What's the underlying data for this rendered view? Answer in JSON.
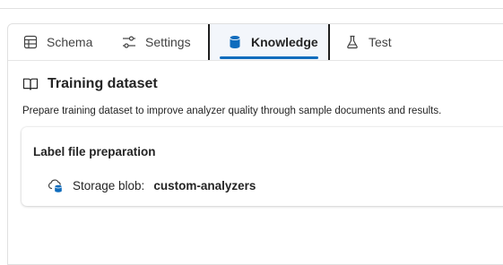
{
  "tabs": [
    {
      "label": "Schema",
      "icon": "table-icon",
      "selected": false
    },
    {
      "label": "Settings",
      "icon": "sliders-icon",
      "selected": false
    },
    {
      "label": "Knowledge",
      "icon": "database-icon",
      "selected": true
    },
    {
      "label": "Test",
      "icon": "beaker-icon",
      "selected": false
    }
  ],
  "section": {
    "title": "Training dataset",
    "icon": "book-icon",
    "description": "Prepare training dataset to improve analyzer quality through sample documents and results."
  },
  "card": {
    "title": "Label file preparation",
    "storage_label": "Storage blob:",
    "storage_value": "custom-analyzers",
    "storage_icon": "cloud-database-icon"
  },
  "colors": {
    "accent": "#0f6cbd",
    "selected_tab_bg": "#f3f6fb",
    "text": "#242424"
  }
}
